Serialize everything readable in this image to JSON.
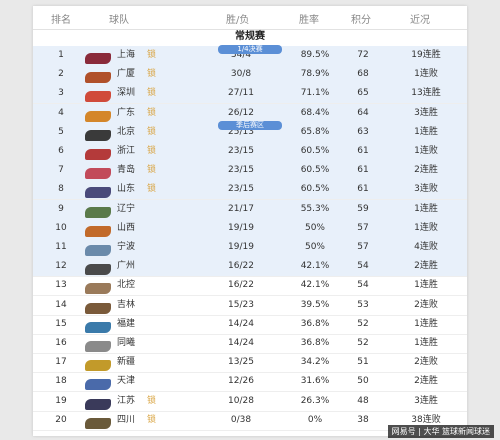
{
  "headers": {
    "rank": "排名",
    "team": "球队",
    "record": "胜/负",
    "pct": "胜率",
    "pts": "积分",
    "streak": "近况"
  },
  "season_title": "常规赛",
  "dividers": {
    "top": "1/4决赛",
    "playin": "季后赛区"
  },
  "seed_tag": "锁",
  "teams": [
    {
      "rank": "1",
      "name": "上海",
      "tag": "锁",
      "record": "34/4",
      "pct": "89.5%",
      "pts": "72",
      "streak": "19连胜",
      "color": "#8a2a3a"
    },
    {
      "rank": "2",
      "name": "广厦",
      "tag": "锁",
      "record": "30/8",
      "pct": "78.9%",
      "pts": "68",
      "streak": "1连败",
      "color": "#b0502a"
    },
    {
      "rank": "3",
      "name": "深圳",
      "tag": "锁",
      "record": "27/11",
      "pct": "71.1%",
      "pts": "65",
      "streak": "13连胜",
      "color": "#d04a3a"
    },
    {
      "rank": "4",
      "name": "广东",
      "tag": "锁",
      "record": "26/12",
      "pct": "68.4%",
      "pts": "64",
      "streak": "3连胜",
      "color": "#d4862a"
    },
    {
      "rank": "5",
      "name": "北京",
      "tag": "锁",
      "record": "25/13",
      "pct": "65.8%",
      "pts": "63",
      "streak": "1连胜",
      "color": "#3a3a3a"
    },
    {
      "rank": "6",
      "name": "浙江",
      "tag": "锁",
      "record": "23/15",
      "pct": "60.5%",
      "pts": "61",
      "streak": "1连败",
      "color": "#b43a3a"
    },
    {
      "rank": "7",
      "name": "青岛",
      "tag": "锁",
      "record": "23/15",
      "pct": "60.5%",
      "pts": "61",
      "streak": "2连胜",
      "color": "#c24a5a"
    },
    {
      "rank": "8",
      "name": "山东",
      "tag": "锁",
      "record": "23/15",
      "pct": "60.5%",
      "pts": "61",
      "streak": "3连败",
      "color": "#4a4a7a"
    },
    {
      "rank": "9",
      "name": "辽宁",
      "tag": "",
      "record": "21/17",
      "pct": "55.3%",
      "pts": "59",
      "streak": "1连胜",
      "color": "#5a7a4a"
    },
    {
      "rank": "10",
      "name": "山西",
      "tag": "",
      "record": "19/19",
      "pct": "50%",
      "pts": "57",
      "streak": "1连败",
      "color": "#c26a2a"
    },
    {
      "rank": "11",
      "name": "宁波",
      "tag": "",
      "record": "19/19",
      "pct": "50%",
      "pts": "57",
      "streak": "4连败",
      "color": "#6a8aaa"
    },
    {
      "rank": "12",
      "name": "广州",
      "tag": "",
      "record": "16/22",
      "pct": "42.1%",
      "pts": "54",
      "streak": "2连胜",
      "color": "#4a4a4a"
    },
    {
      "rank": "13",
      "name": "北控",
      "tag": "",
      "record": "16/22",
      "pct": "42.1%",
      "pts": "54",
      "streak": "1连胜",
      "color": "#9a7a5a"
    },
    {
      "rank": "14",
      "name": "吉林",
      "tag": "",
      "record": "15/23",
      "pct": "39.5%",
      "pts": "53",
      "streak": "2连败",
      "color": "#7a5a3a"
    },
    {
      "rank": "15",
      "name": "福建",
      "tag": "",
      "record": "14/24",
      "pct": "36.8%",
      "pts": "52",
      "streak": "1连胜",
      "color": "#3a7aaa"
    },
    {
      "rank": "16",
      "name": "同曦",
      "tag": "",
      "record": "14/24",
      "pct": "36.8%",
      "pts": "52",
      "streak": "1连胜",
      "color": "#8a8a8a"
    },
    {
      "rank": "17",
      "name": "新疆",
      "tag": "",
      "record": "13/25",
      "pct": "34.2%",
      "pts": "51",
      "streak": "2连败",
      "color": "#c29a2a"
    },
    {
      "rank": "18",
      "name": "天津",
      "tag": "",
      "record": "12/26",
      "pct": "31.6%",
      "pts": "50",
      "streak": "2连胜",
      "color": "#4a6aaa"
    },
    {
      "rank": "19",
      "name": "江苏",
      "tag": "锁",
      "record": "10/28",
      "pct": "26.3%",
      "pts": "48",
      "streak": "3连胜",
      "color": "#3a3a5a"
    },
    {
      "rank": "20",
      "name": "四川",
      "tag": "锁",
      "record": "0/38",
      "pct": "0%",
      "pts": "38",
      "streak": "38连败",
      "color": "#6a5a3a"
    }
  ],
  "watermark": "网易号 | 大华 篮球新闻球迷"
}
